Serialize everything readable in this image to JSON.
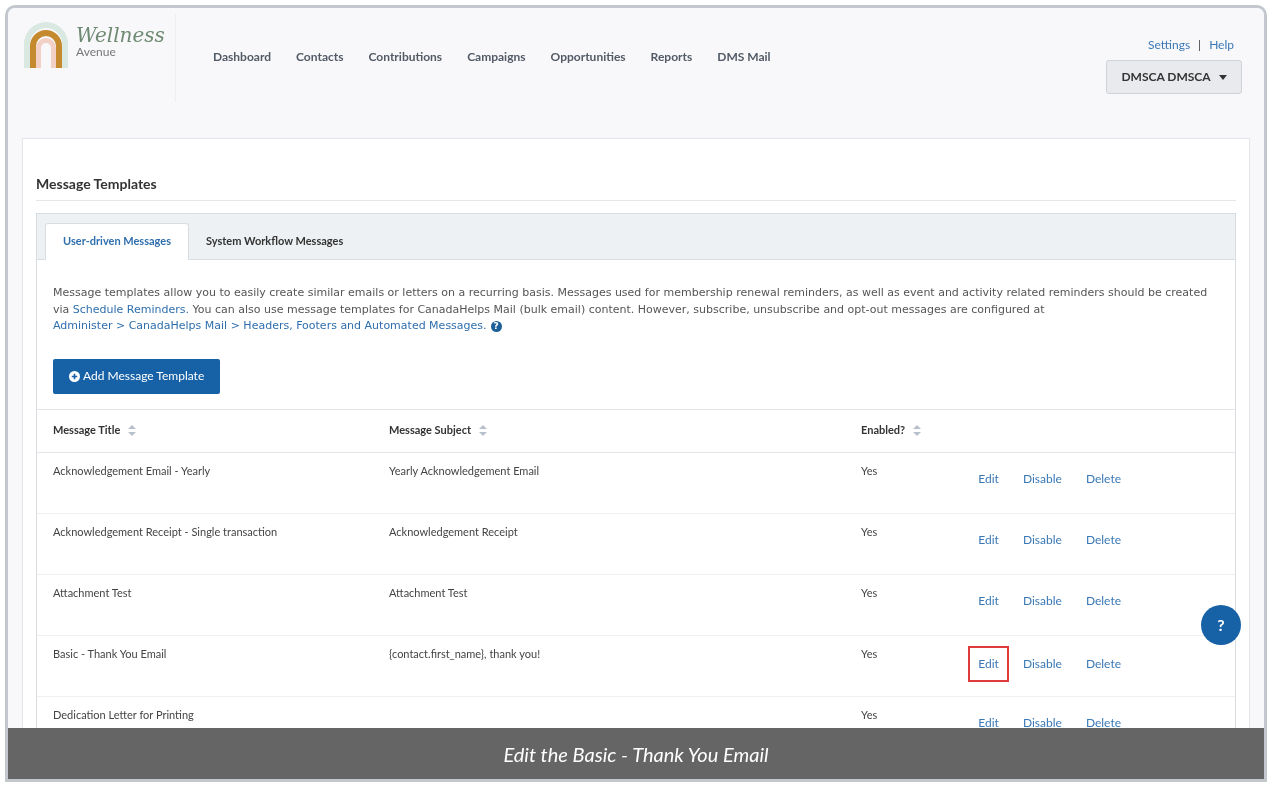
{
  "logo": {
    "name": "Wellness",
    "tagline": "Avenue"
  },
  "nav": [
    "Dashboard",
    "Contacts",
    "Contributions",
    "Campaigns",
    "Opportunities",
    "Reports",
    "DMS Mail"
  ],
  "top_links": [
    "Settings",
    "|",
    "Help"
  ],
  "user_menu": {
    "label": "DMSCA DMSCA"
  },
  "page_title": "Message Templates",
  "tabs": [
    {
      "label": "User-driven Messages",
      "selected": true
    },
    {
      "label": "System Workflow Messages",
      "selected": false
    }
  ],
  "description": [
    {
      "kind": "text",
      "text": "Message templates allow you to easily create similar emails or letters on a recurring basis. Messages used for membership renewal reminders, as well as event and activity related reminders should be created via "
    },
    {
      "kind": "link",
      "text": "Schedule Reminders."
    },
    {
      "kind": "text",
      "text": " You can also use message templates for CanadaHelps Mail (bulk email) content. However, subscribe, unsubscribe and opt-out messages are configured at "
    },
    {
      "kind": "link",
      "text": "Administer > CanadaHelps Mail > Headers, Footers and Automated Messages."
    },
    {
      "kind": "help",
      "text": "?"
    }
  ],
  "add_button": "Add Message Template",
  "table": {
    "columns": [
      "Message Title",
      "Message Subject",
      "Enabled?"
    ],
    "rows": [
      {
        "title": "Acknowledgement Email - Yearly",
        "subject": "Yearly Acknowledgement Email",
        "enabled": "Yes",
        "actions": [
          {
            "label": "Edit",
            "highlighted": false
          },
          {
            "label": "Disable",
            "highlighted": false
          },
          {
            "label": "Delete",
            "highlighted": false
          }
        ]
      },
      {
        "title": "Acknowledgement Receipt - Single transaction",
        "subject": "Acknowledgement Receipt",
        "enabled": "Yes",
        "actions": [
          {
            "label": "Edit",
            "highlighted": false
          },
          {
            "label": "Disable",
            "highlighted": false
          },
          {
            "label": "Delete",
            "highlighted": false
          }
        ]
      },
      {
        "title": "Attachment Test",
        "subject": "Attachment Test",
        "enabled": "Yes",
        "actions": [
          {
            "label": "Edit",
            "highlighted": false
          },
          {
            "label": "Disable",
            "highlighted": false
          },
          {
            "label": "Delete",
            "highlighted": false
          }
        ]
      },
      {
        "title": "Basic - Thank You Email",
        "subject": "{contact.first_name}, thank you!",
        "enabled": "Yes",
        "actions": [
          {
            "label": "Edit",
            "highlighted": true
          },
          {
            "label": "Disable",
            "highlighted": false
          },
          {
            "label": "Delete",
            "highlighted": false
          }
        ]
      },
      {
        "title": "Dedication Letter for Printing",
        "enabled": "Yes",
        "actions": [
          {
            "label": "Edit",
            "highlighted": false
          },
          {
            "label": "Disable",
            "highlighted": false
          },
          {
            "label": "Delete",
            "highlighted": false
          }
        ]
      }
    ]
  },
  "help_button": "?",
  "caption": "Edit the Basic - Thank You Email"
}
